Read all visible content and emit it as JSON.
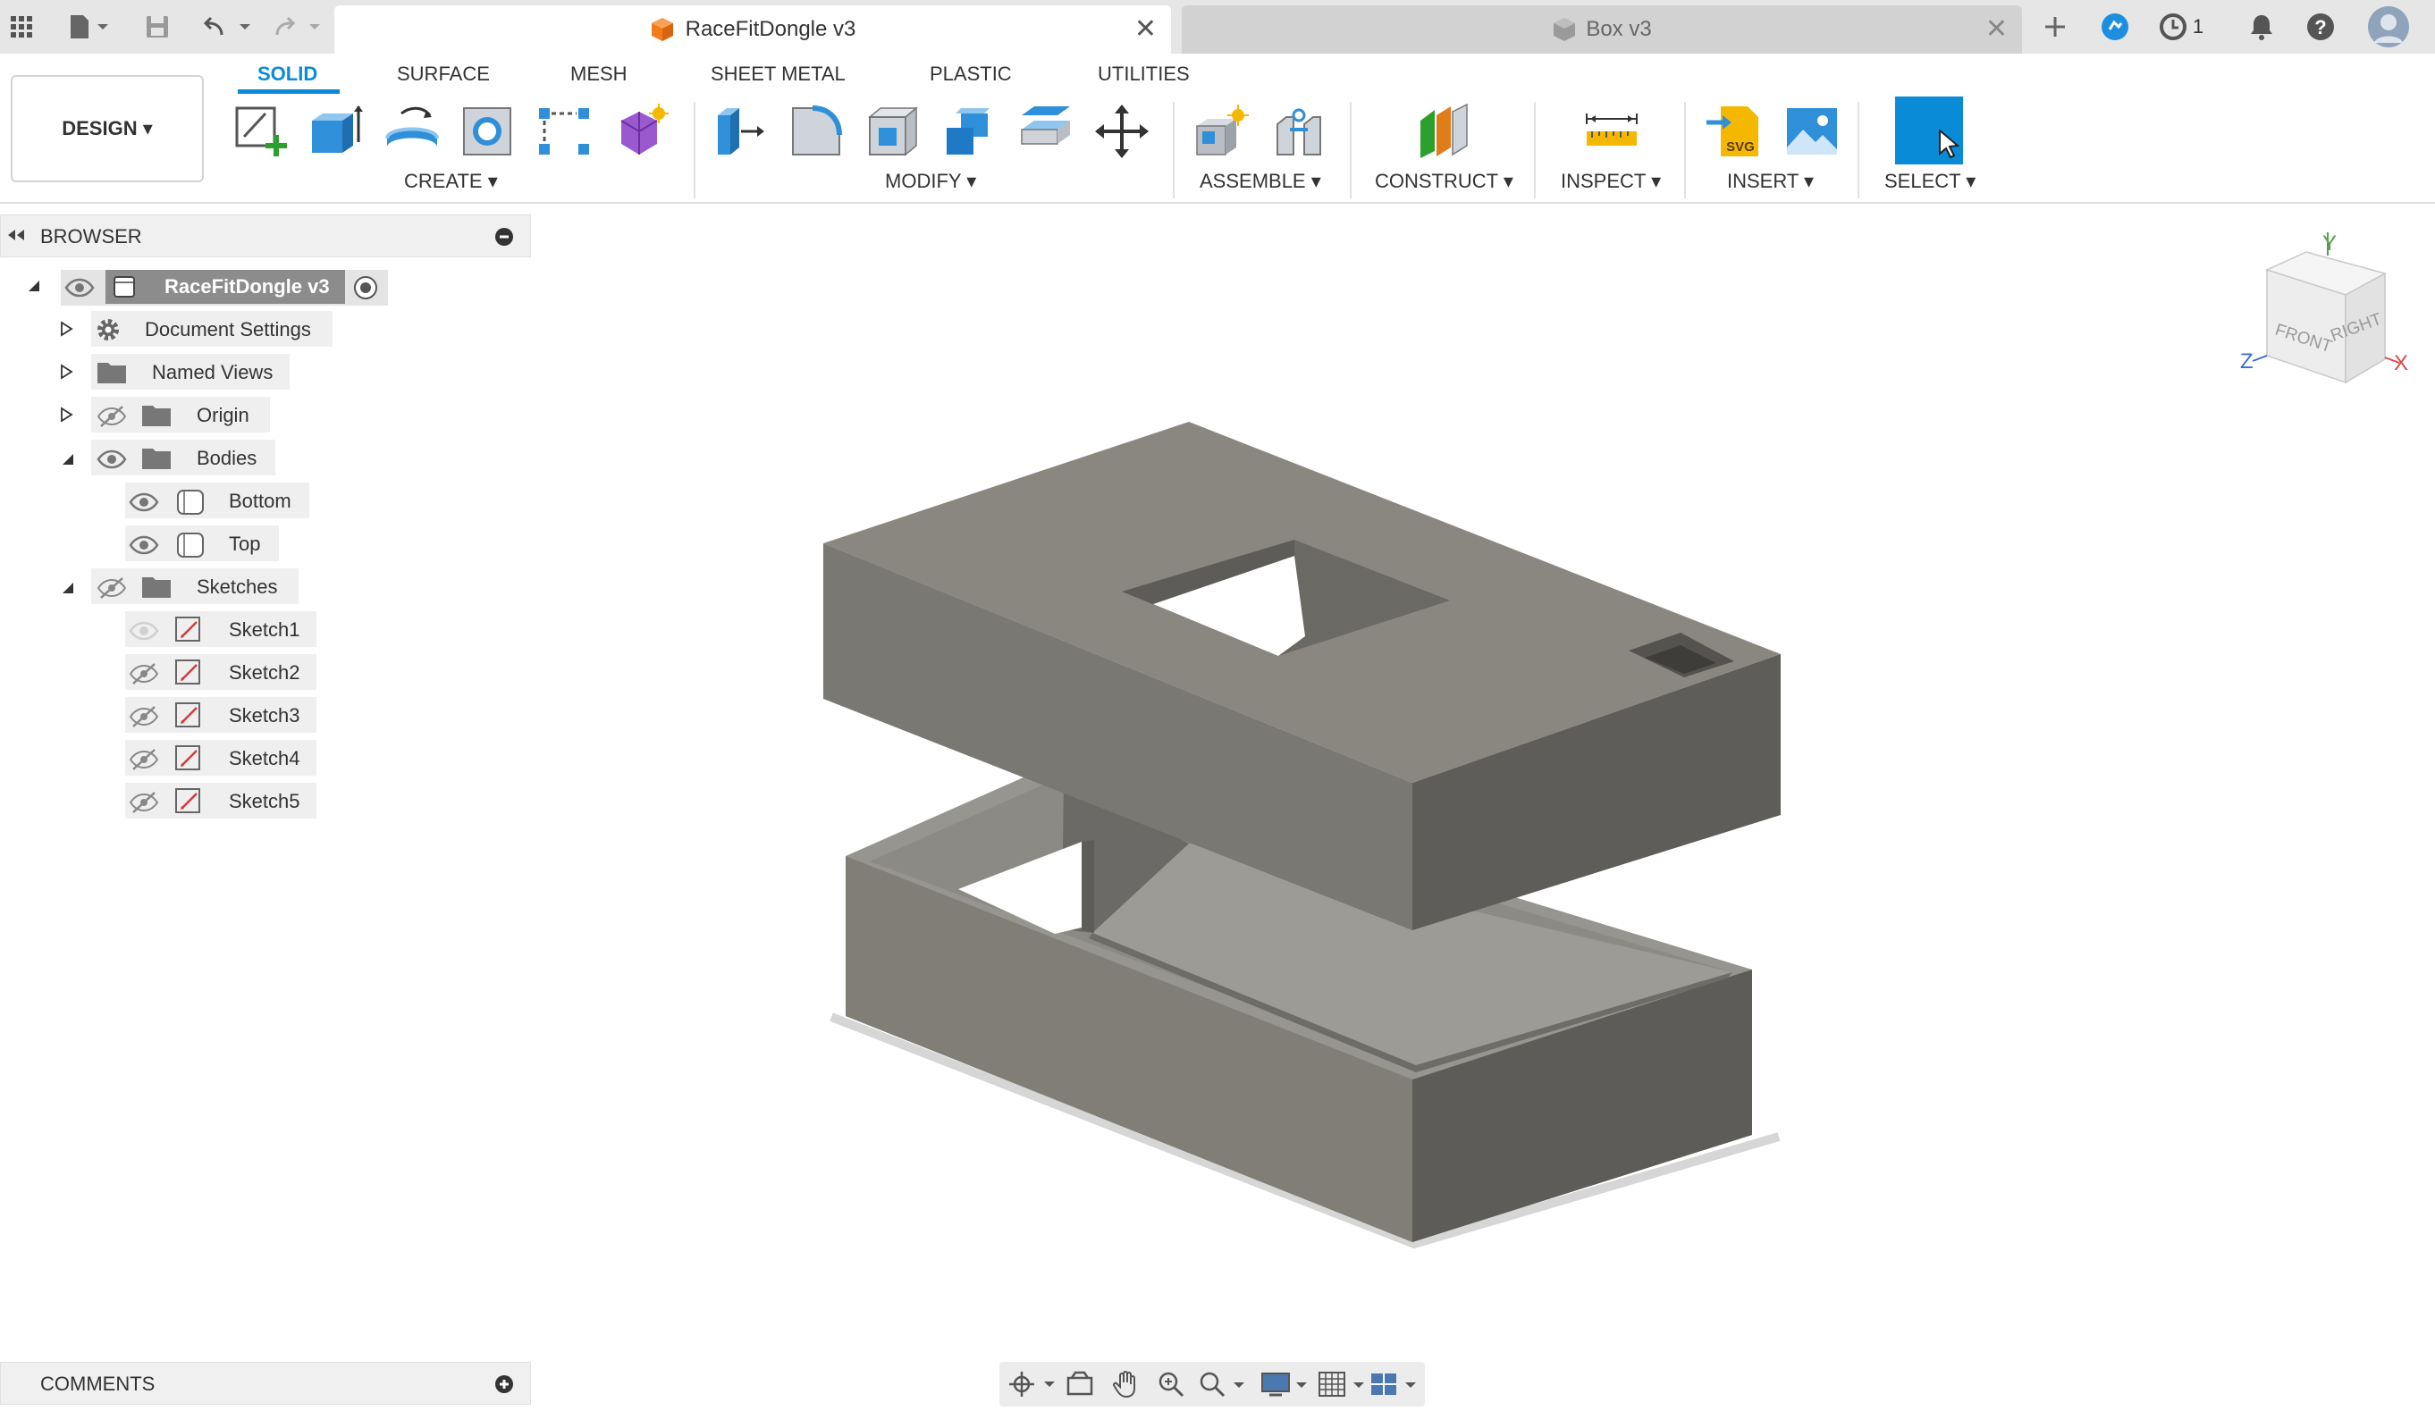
{
  "tabs": {
    "active_title": "RaceFitDongle v3",
    "inactive_title": "Box v3",
    "job_count": "1"
  },
  "toolbar": {
    "design_label": "DESIGN ▾",
    "workspace_tabs": [
      "SOLID",
      "SURFACE",
      "MESH",
      "SHEET METAL",
      "PLASTIC",
      "UTILITIES"
    ],
    "groups": {
      "create": "CREATE ▾",
      "modify": "MODIFY ▾",
      "assemble": "ASSEMBLE ▾",
      "construct": "CONSTRUCT ▾",
      "inspect": "INSPECT ▾",
      "insert": "INSERT ▾",
      "select": "SELECT ▾"
    }
  },
  "browser": {
    "title": "BROWSER",
    "root": "RaceFitDongle v3",
    "items": {
      "document_settings": "Document Settings",
      "named_views": "Named Views",
      "origin": "Origin",
      "bodies": "Bodies",
      "bottom": "Bottom",
      "top": "Top",
      "sketches": "Sketches",
      "sketch1": "Sketch1",
      "sketch2": "Sketch2",
      "sketch3": "Sketch3",
      "sketch4": "Sketch4",
      "sketch5": "Sketch5"
    }
  },
  "comments": {
    "title": "COMMENTS"
  },
  "viewcube": {
    "front": "FRONT",
    "right": "RIGHT",
    "axis_x": "X",
    "axis_y": "Y",
    "axis_z": "Z"
  },
  "colors": {
    "accent": "#0a8bd8",
    "body_grey": "#8a8780",
    "panel_bg": "#f0f0f0"
  }
}
